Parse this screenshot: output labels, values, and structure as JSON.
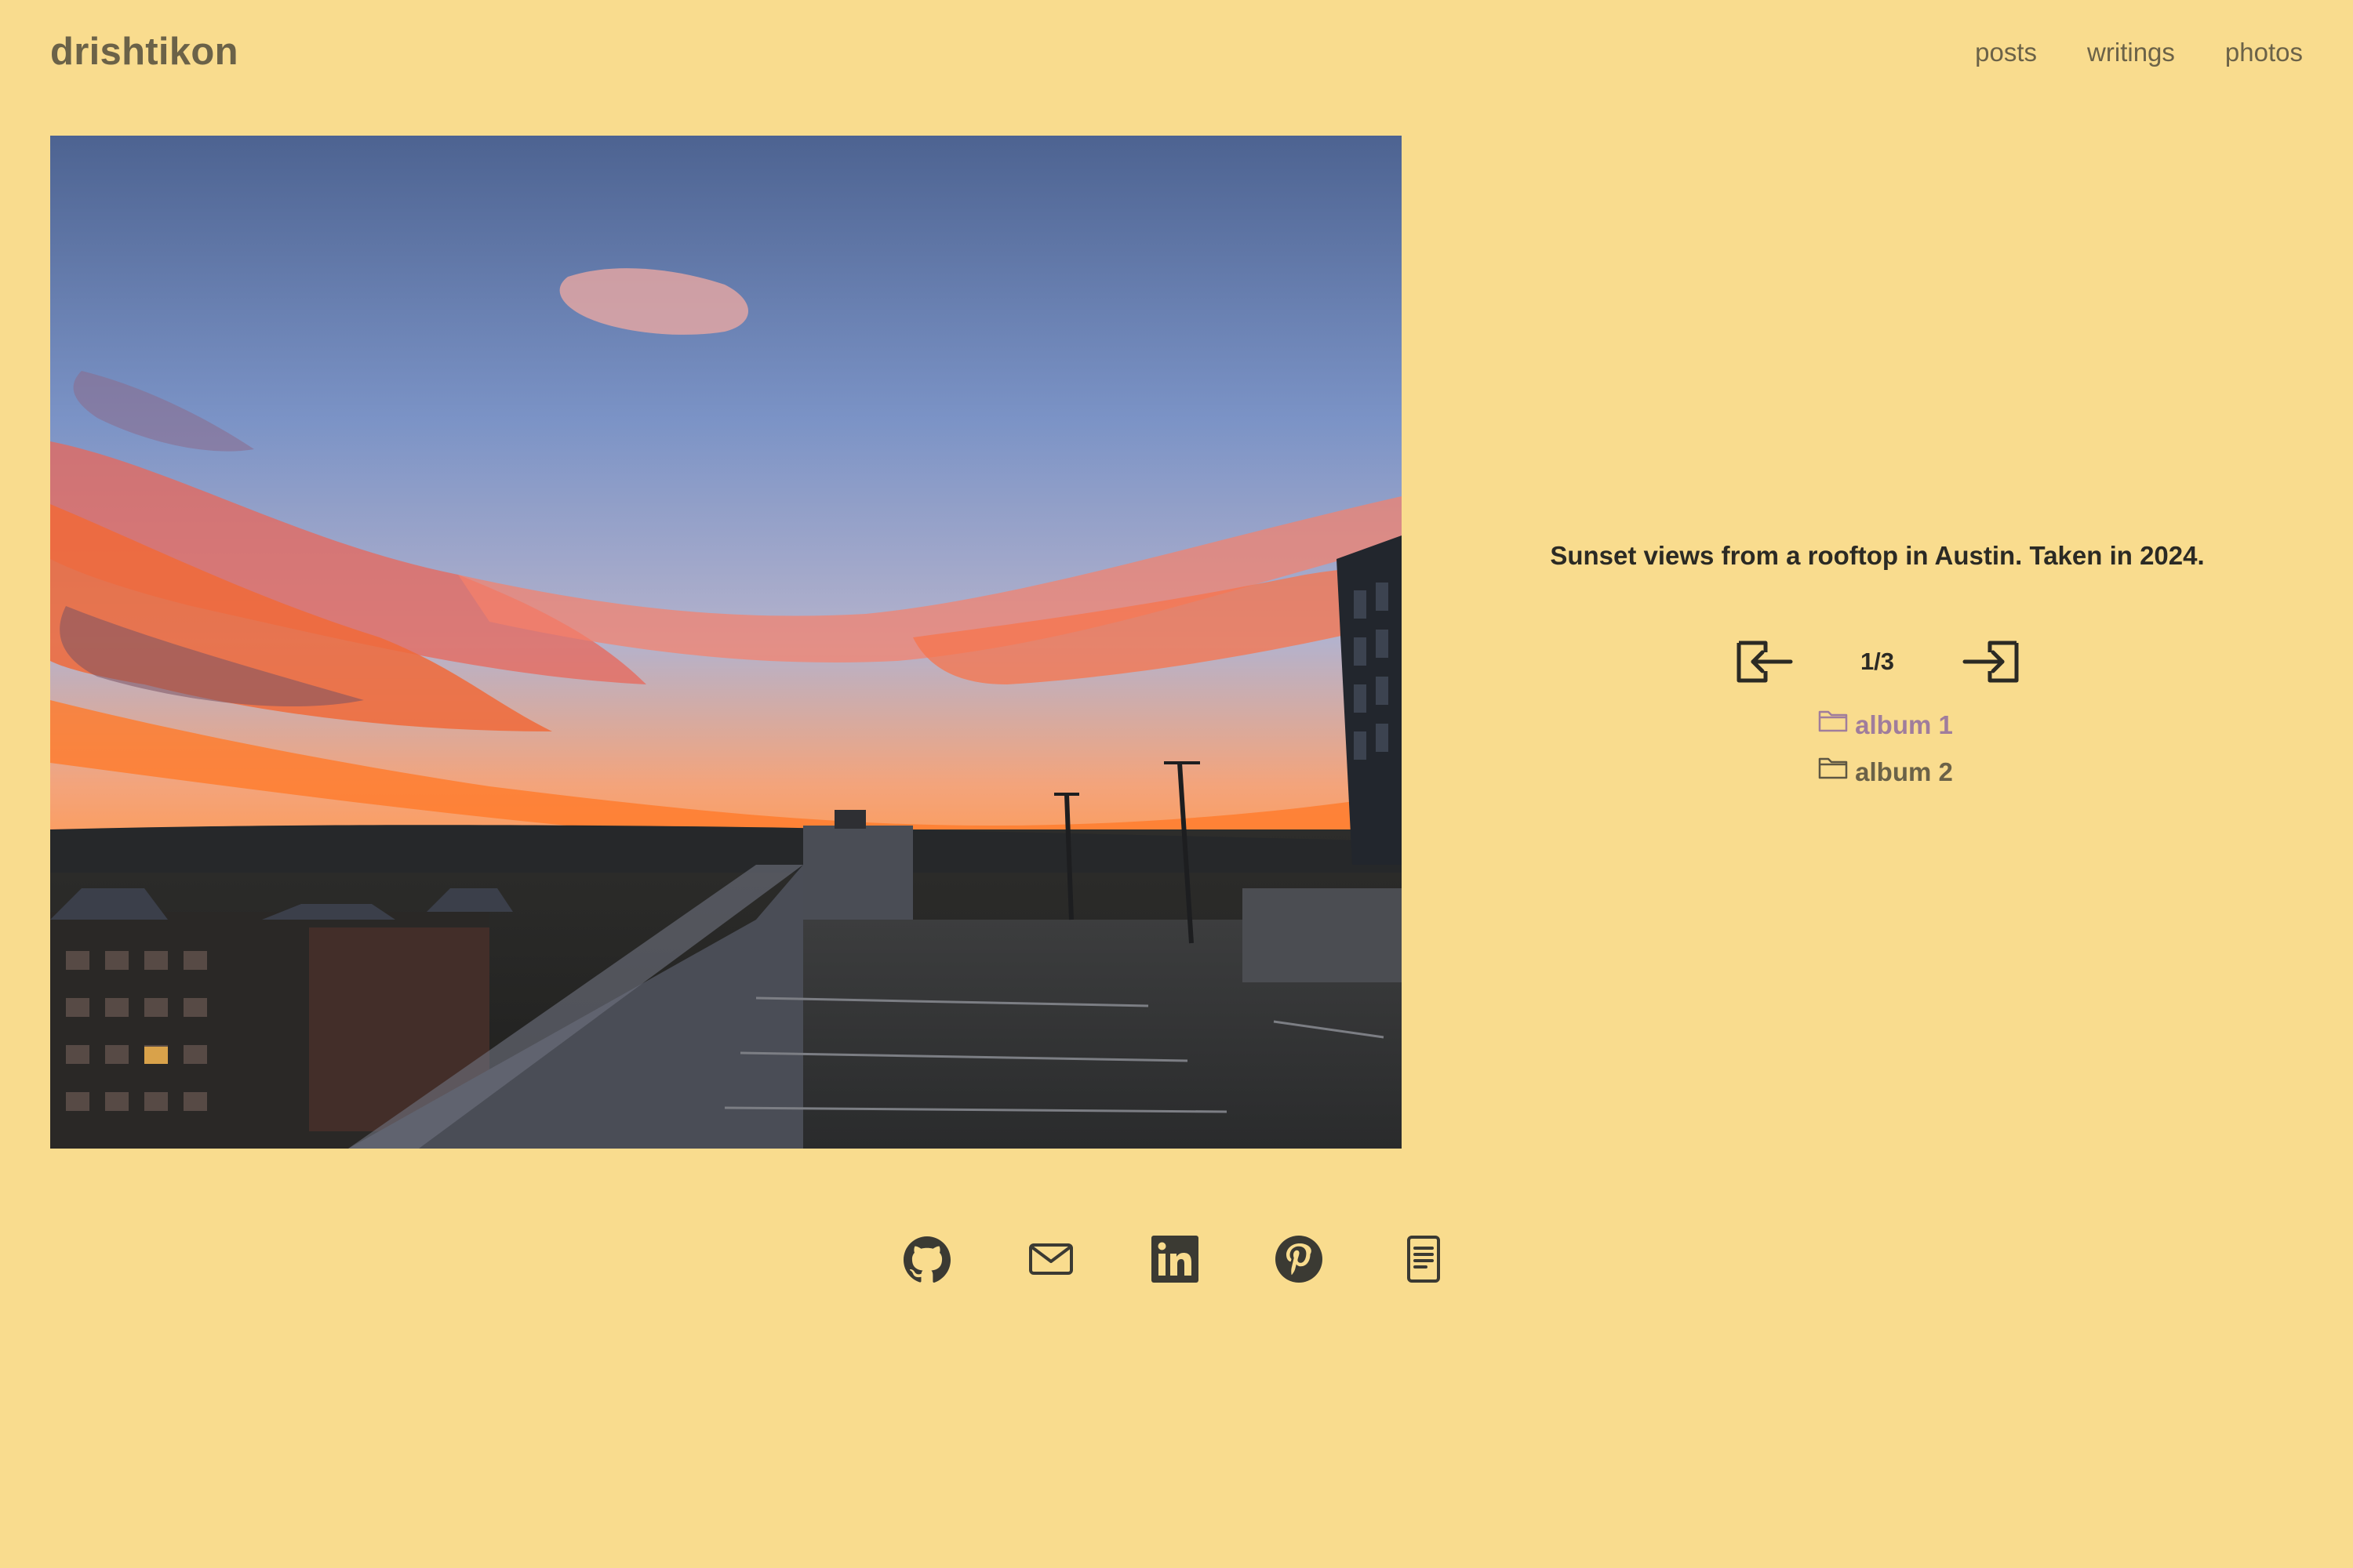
{
  "site": {
    "title": "drishtikon"
  },
  "nav": {
    "items": [
      "posts",
      "writings",
      "photos"
    ]
  },
  "photo": {
    "description_alt": "Sunset views from a rooftop in Austin."
  },
  "caption": "Sunset views from a rooftop in Austin. Taken in 2024.",
  "pager": {
    "counter": "1/3",
    "prev_icon": "arrow-left-box-icon",
    "next_icon": "arrow-right-box-icon"
  },
  "albums": [
    {
      "label": "album 1",
      "icon": "folder-icon",
      "state": "visited"
    },
    {
      "label": "album 2",
      "icon": "folder-icon",
      "state": "normal"
    }
  ],
  "social": [
    "github-icon",
    "mail-icon",
    "linkedin-icon",
    "pinterest-icon",
    "document-icon"
  ],
  "colors": {
    "background": "#f9dc8e",
    "text": "#5e5743",
    "caption": "#2b2a24",
    "visited_link": "#a07d9c"
  }
}
